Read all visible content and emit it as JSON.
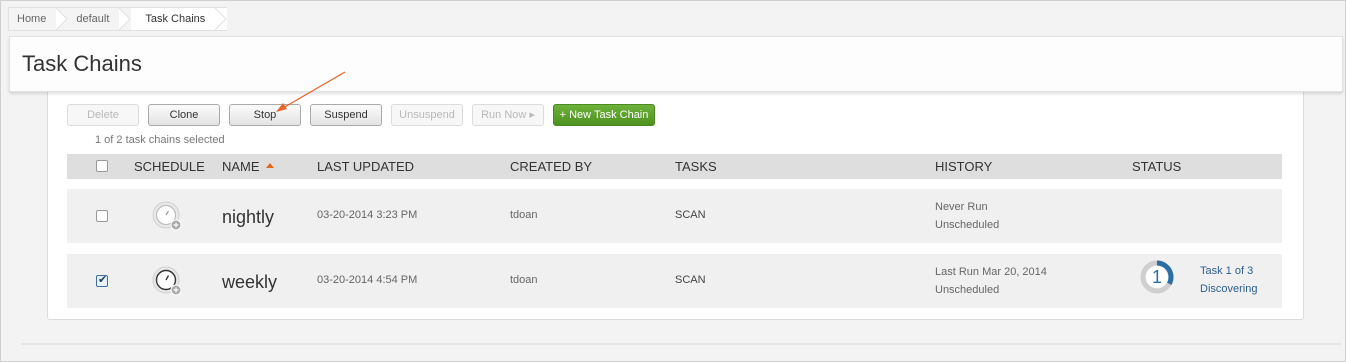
{
  "breadcrumb": [
    {
      "label": "Home"
    },
    {
      "label": "default"
    },
    {
      "label": "Task Chains"
    }
  ],
  "page": {
    "title": "Task Chains"
  },
  "toolbar": {
    "delete": "Delete",
    "clone": "Clone",
    "stop": "Stop",
    "suspend": "Suspend",
    "unsuspend": "Unsuspend",
    "run_now": "Run Now ▸",
    "new_chain": "+ New Task Chain"
  },
  "selection": {
    "text": "1 of 2 task chains selected"
  },
  "table": {
    "columns": {
      "schedule": "SCHEDULE",
      "name": "NAME",
      "last_updated": "LAST UPDATED",
      "created_by": "CREATED BY",
      "tasks": "TASKS",
      "history": "HISTORY",
      "status": "STATUS"
    },
    "sort": {
      "column": "name",
      "direction": "ascending"
    },
    "rows": [
      {
        "checked": false,
        "name": "nightly",
        "last_updated": "03-20-2014 3:23 PM",
        "created_by": "tdoan",
        "tasks": "SCAN",
        "history_line1": "Never Run",
        "history_line2": "Unscheduled"
      },
      {
        "checked": true,
        "name": "weekly",
        "last_updated": "03-20-2014 4:54 PM",
        "created_by": "tdoan",
        "tasks": "SCAN",
        "history_line1": "Last Run Mar 20, 2014",
        "history_line2": "Unscheduled",
        "status_number": "1",
        "status_progress": 0.33,
        "status_line1": "Task 1 of 3",
        "status_line2": "Discovering"
      }
    ]
  },
  "icons": {
    "schedule": "clock-icon",
    "schedule_add": "plus-badge-icon",
    "sort": "sort-ascending-icon",
    "annotation": "annotation-arrow"
  },
  "colors": {
    "primary_button": "#5ba22b",
    "annotation_arrow": "#e8642a",
    "link": "#2d5f93",
    "progress": "#2d6da3"
  }
}
